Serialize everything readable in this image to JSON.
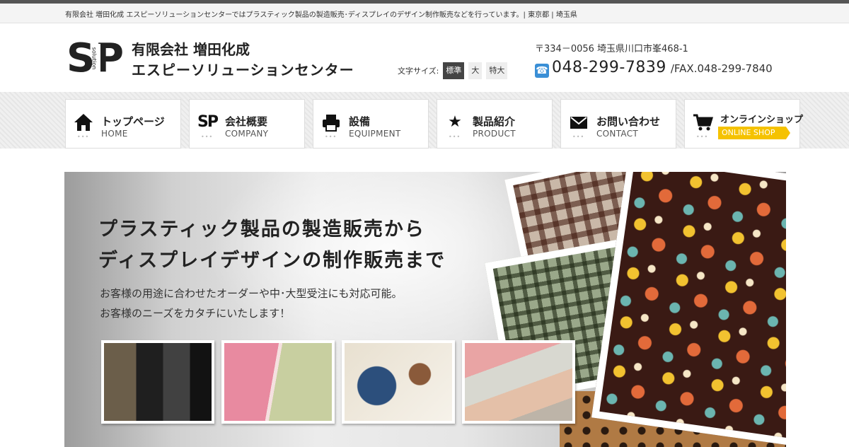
{
  "topbar": {
    "text": "有限会社 増田化成 エスピーソリューションセンターではプラスティック製品の製造販売･ディスプレイのデザイン制作販売などを行っています。| 東京都 | 埼玉県"
  },
  "header": {
    "logo_text_s": "S",
    "logo_text_p": "P",
    "logo_sub": "solution",
    "company_line1": "有限会社 増田化成",
    "company_line2": "エスピーソリューションセンター",
    "fontsize_label": "文字サイズ:",
    "fontsize_options": [
      "標準",
      "大",
      "特大"
    ],
    "fontsize_selected": "標準",
    "address": "〒334－0056 埼玉県川口市峯468-1",
    "tel": "048-299-7839",
    "fax": "/FAX.048-299-7840"
  },
  "nav": [
    {
      "ja": "トップページ",
      "en": "HOME",
      "icon": "home-icon"
    },
    {
      "ja": "会社概要",
      "en": "COMPANY",
      "icon": "sp-logo-icon"
    },
    {
      "ja": "設備",
      "en": "EQUIPMENT",
      "icon": "printer-icon"
    },
    {
      "ja": "製品紹介",
      "en": "PRODUCT",
      "icon": "star-icon"
    },
    {
      "ja": "お問い合わせ",
      "en": "CONTACT",
      "icon": "envelope-icon"
    },
    {
      "ja": "オンラインショップ",
      "en": "ONLINE SHOP",
      "icon": "cart-icon"
    }
  ],
  "hero": {
    "title_line1": "プラスティック製品の製造販売から",
    "title_line2": "ディスプレイデザインの制作販売まで",
    "sub_line1": "お客様の用途に合わせたオーダーや中･大型受注にも対応可能。",
    "sub_line2": "お客様のニーズをカタチにいたします！"
  },
  "colors": {
    "accent_shop": "#f5c200",
    "tel_icon": "#3a8fd6",
    "active_fontsize": "#444444"
  }
}
